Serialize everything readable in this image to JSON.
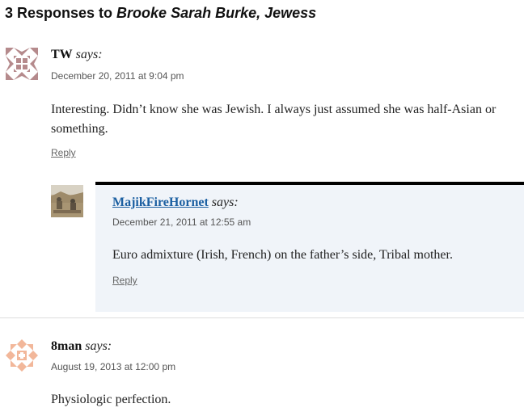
{
  "header": {
    "count_prefix": "3 Responses to ",
    "post_title": "Brooke Sarah Burke, Jewess"
  },
  "comments": [
    {
      "author": "TW",
      "says": "says:",
      "date": "December 20, 2011 at 9:04 pm",
      "text": "Interesting. Didn’t know she was Jewish. I always just assumed she was half-Asian or something.",
      "reply": "Reply",
      "avatar": "identicon-mauve",
      "avatar_color": "#b58a8c"
    },
    {
      "author": "MajikFireHornet",
      "says": "says:",
      "date": "December 21, 2011 at 12:55 am",
      "text": "Euro admixture (Irish, French) on the father’s side, Tribal mother.",
      "reply": "Reply",
      "avatar": "photo-avatar-desert-soldiers",
      "author_color": "#1b5fa1",
      "box_color": "#f0f4f9"
    },
    {
      "author": "8man",
      "says": "says:",
      "date": "August 19, 2013 at 12:00 pm",
      "text": "Physiologic perfection.",
      "avatar": "identicon-peach",
      "avatar_color": "#f2b79a"
    }
  ]
}
